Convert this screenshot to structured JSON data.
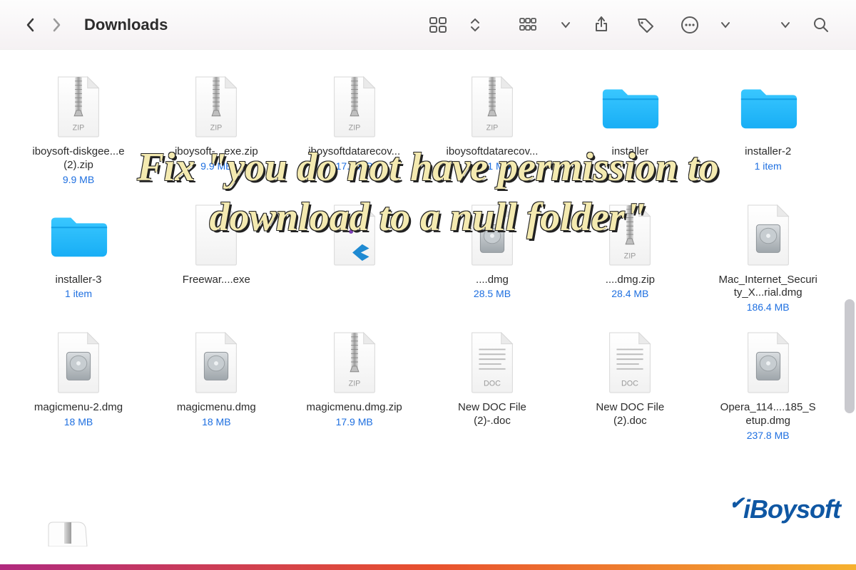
{
  "location_title": "Downloads",
  "overlay_text": "Fix \"you do not have permission to download to a null folder\"",
  "watermark": "iBoysoft",
  "items": [
    {
      "kind": "zip",
      "name": "iboysoft-diskgee...e (2).zip",
      "sub": "9.9 MB"
    },
    {
      "kind": "zip",
      "name": "iboysoft-...exe.zip",
      "sub": "9.9 MB"
    },
    {
      "kind": "zip",
      "name": "iboysoftdatarecov...",
      "sub": "17.1 MB"
    },
    {
      "kind": "zip",
      "name": "iboysoftdatarecov...",
      "sub": "17.1 MB"
    },
    {
      "kind": "folder",
      "name": "installer",
      "sub": ""
    },
    {
      "kind": "folder",
      "name": "installer-2",
      "sub": "1 item"
    },
    {
      "kind": "folder",
      "name": "installer-3",
      "sub": "1 item"
    },
    {
      "kind": "exe",
      "name": "Freewar....exe",
      "sub": ""
    },
    {
      "kind": "vscode",
      "name": "",
      "sub": ""
    },
    {
      "kind": "dmg",
      "name": "....dmg",
      "sub": "28.5 MB"
    },
    {
      "kind": "zip",
      "name": "....dmg.zip",
      "sub": "28.4 MB"
    },
    {
      "kind": "dmg",
      "name": "Mac_Internet_Security_X...rial.dmg",
      "sub": "186.4 MB"
    },
    {
      "kind": "dmg",
      "name": "magicmenu-2.dmg",
      "sub": "18 MB"
    },
    {
      "kind": "dmg",
      "name": "magicmenu.dmg",
      "sub": "18 MB"
    },
    {
      "kind": "zip",
      "name": "magicmenu.dmg.zip",
      "sub": "17.9 MB"
    },
    {
      "kind": "doc",
      "name": "New DOC File (2)-.doc",
      "sub": ""
    },
    {
      "kind": "doc",
      "name": "New DOC File (2).doc",
      "sub": ""
    },
    {
      "kind": "dmg",
      "name": "Opera_114....185_Setup.dmg",
      "sub": "237.8 MB"
    }
  ],
  "icon_labels": {
    "zip": "ZIP",
    "doc": "DOC"
  }
}
